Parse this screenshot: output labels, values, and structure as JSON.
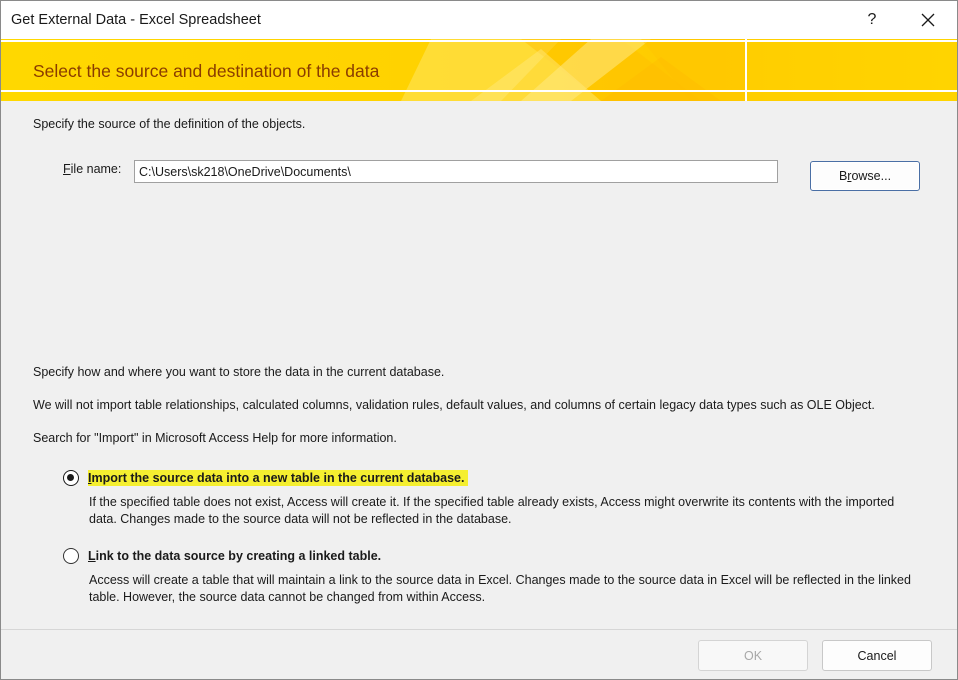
{
  "window": {
    "title": "Get External Data - Excel Spreadsheet",
    "help_glyph": "?",
    "close_glyph": "close-icon"
  },
  "banner": {
    "heading": "Select the source and destination of the data",
    "colors": {
      "base": "#ffd200",
      "heading": "#8a3c00"
    }
  },
  "source": {
    "intro": "Specify the source of the definition of the objects.",
    "file_label_mnemonic": "F",
    "file_label_rest": "ile name:",
    "file_value": "C:\\Users\\sk218\\OneDrive\\Documents\\",
    "browse_mnemonic": "r",
    "browse_pre": "B",
    "browse_post": "owse..."
  },
  "storage": {
    "intro": "Specify how and where you want to store the data in the current database.",
    "note": "We will not import table relationships, calculated columns, validation rules, default values, and columns of certain legacy data types such as OLE Object.",
    "help": "Search for \"Import\" in Microsoft Access Help for more information.",
    "options": [
      {
        "mnemonic": "I",
        "label_rest": "mport the source data into a new table in the current database.",
        "selected": true,
        "description": "If the specified table does not exist, Access will create it. If the specified table already exists, Access might overwrite its contents with the imported data. Changes made to the source data will not be reflected in the database."
      },
      {
        "mnemonic": "L",
        "label_rest": "ink to the data source by creating a linked table.",
        "selected": false,
        "description": "Access will create a table that will maintain a link to the source data in Excel. Changes made to the source data in Excel will be reflected in the linked table. However, the source data cannot be changed from within Access."
      }
    ]
  },
  "footer": {
    "ok_label": "OK",
    "ok_enabled": false,
    "cancel_label": "Cancel"
  }
}
